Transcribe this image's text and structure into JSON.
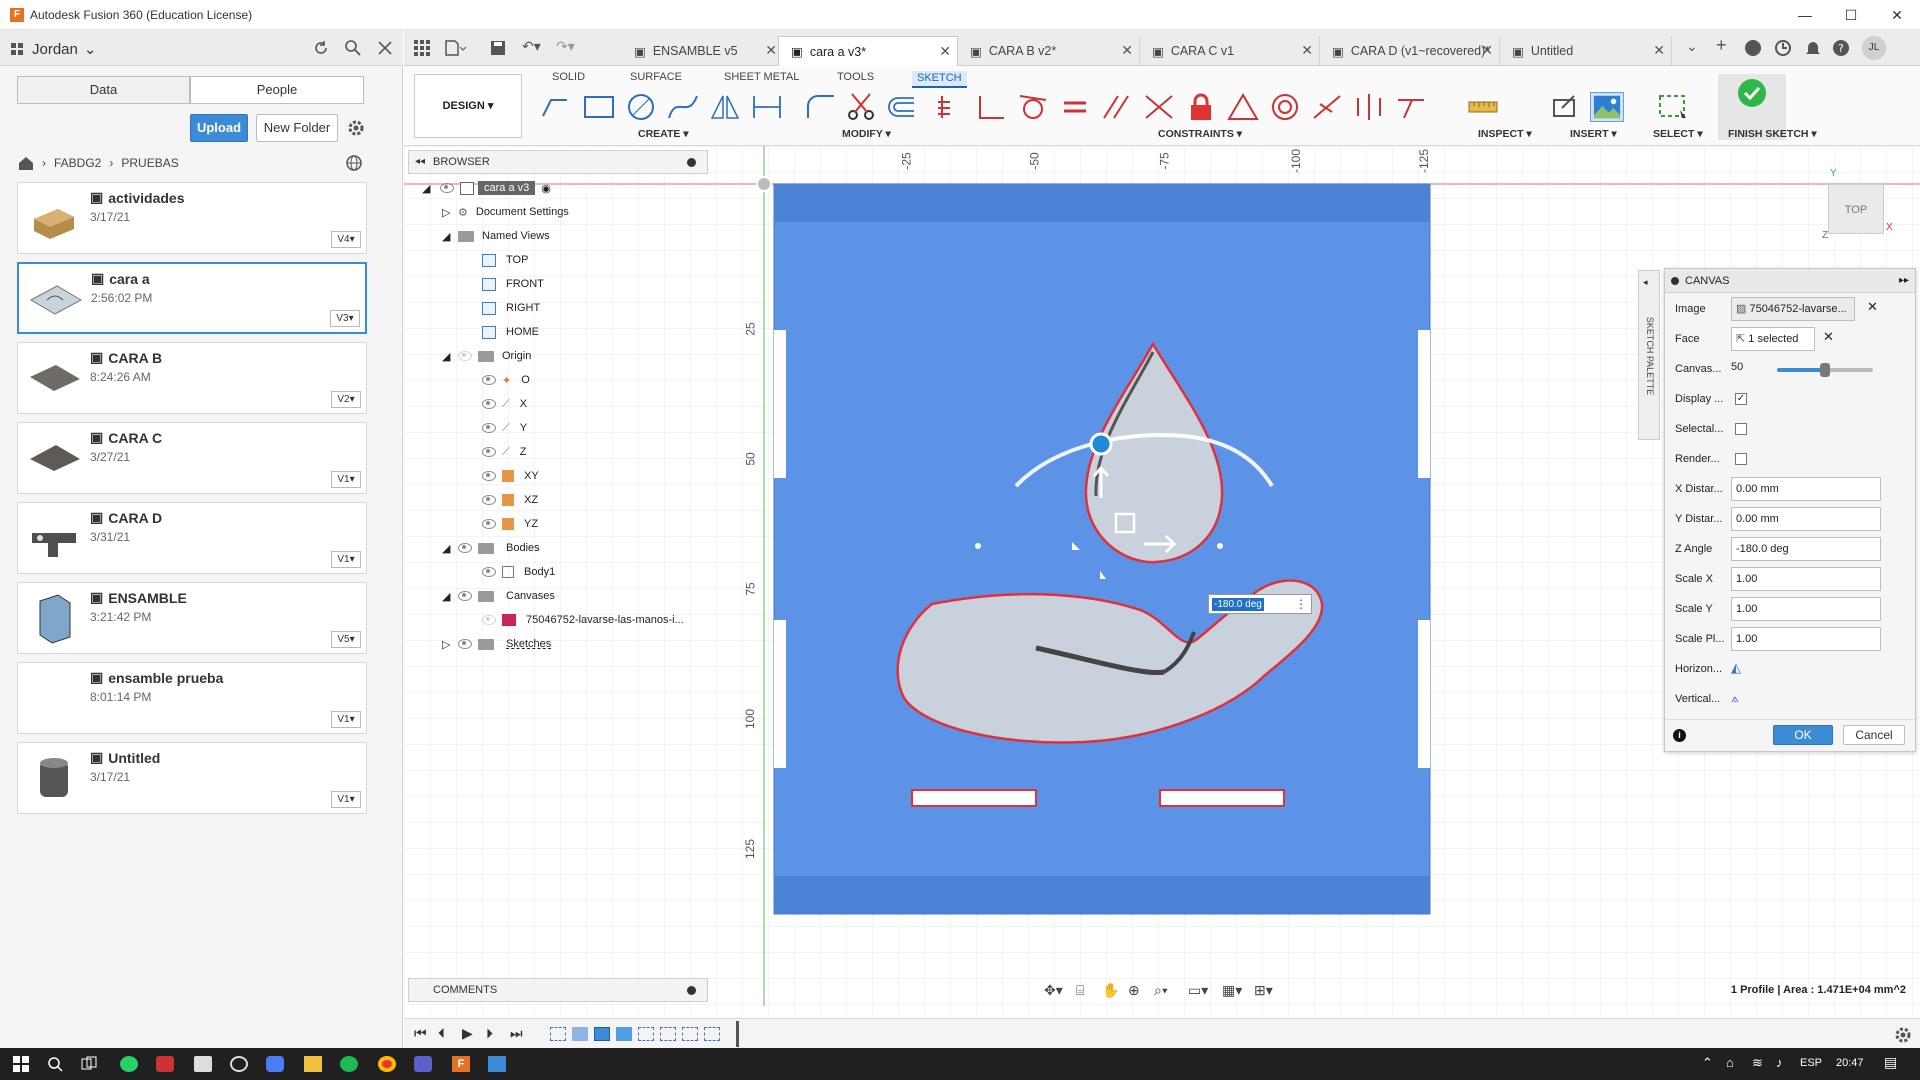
{
  "window": {
    "title": "Autodesk Fusion 360 (Education License)",
    "minimize": "—",
    "maximize": "☐",
    "close": "✕"
  },
  "data_panel": {
    "user": "Jordan",
    "tabs": [
      "Data",
      "People"
    ],
    "upload": "Upload",
    "new_folder": "New Folder",
    "breadcrumb": [
      "FABDG2",
      "PRUEBAS"
    ],
    "items": [
      {
        "name": "actividades",
        "date": "3/17/21",
        "version": "V4"
      },
      {
        "name": "cara a",
        "date": "2:56:02 PM",
        "version": "V3"
      },
      {
        "name": "CARA B",
        "date": "8:24:26 AM",
        "version": "V2"
      },
      {
        "name": "CARA C",
        "date": "3/27/21",
        "version": "V1"
      },
      {
        "name": "CARA D",
        "date": "3/31/21",
        "version": "V1"
      },
      {
        "name": "ENSAMBLE",
        "date": "3:21:42 PM",
        "version": "V5"
      },
      {
        "name": "ensamble prueba",
        "date": "8:01:14 PM",
        "version": "V1"
      },
      {
        "name": "Untitled",
        "date": "3/17/21",
        "version": "V1"
      }
    ]
  },
  "doc_tabs": [
    {
      "label": "ENSAMBLE v5",
      "active": false
    },
    {
      "label": "cara a v3*",
      "active": true
    },
    {
      "label": "CARA B v2*",
      "active": false
    },
    {
      "label": "CARA C v1",
      "active": false
    },
    {
      "label": "CARA D (v1~recovered)*",
      "active": false
    },
    {
      "label": "Untitled",
      "active": false
    }
  ],
  "toolbar": {
    "workspace": "DESIGN ▾",
    "tabs": [
      "SOLID",
      "SURFACE",
      "SHEET METAL",
      "TOOLS",
      "SKETCH"
    ],
    "groups": {
      "create": "CREATE ▾",
      "modify": "MODIFY ▾",
      "constraints": "CONSTRAINTS ▾",
      "inspect": "INSPECT ▾",
      "insert": "INSERT ▾",
      "select": "SELECT ▾",
      "finish": "FINISH SKETCH ▾"
    }
  },
  "browser": {
    "title": "BROWSER",
    "tree": [
      {
        "label": "cara a v3",
        "indent": 0
      },
      {
        "label": "Document Settings",
        "indent": 1
      },
      {
        "label": "Named Views",
        "indent": 1
      },
      {
        "label": "TOP",
        "indent": 2
      },
      {
        "label": "FRONT",
        "indent": 2
      },
      {
        "label": "RIGHT",
        "indent": 2
      },
      {
        "label": "HOME",
        "indent": 2
      },
      {
        "label": "Origin",
        "indent": 1
      },
      {
        "label": "O",
        "indent": 2
      },
      {
        "label": "X",
        "indent": 2
      },
      {
        "label": "Y",
        "indent": 2
      },
      {
        "label": "Z",
        "indent": 2
      },
      {
        "label": "XY",
        "indent": 2
      },
      {
        "label": "XZ",
        "indent": 2
      },
      {
        "label": "YZ",
        "indent": 2
      },
      {
        "label": "Bodies",
        "indent": 1
      },
      {
        "label": "Body1",
        "indent": 2
      },
      {
        "label": "Canvases",
        "indent": 1
      },
      {
        "label": "75046752-lavarse-las-manos-i...",
        "indent": 2
      },
      {
        "label": "Sketches",
        "indent": 1
      }
    ]
  },
  "rulers": {
    "top": [
      "-25",
      "-50",
      "-75",
      "-100",
      "-125"
    ],
    "left": [
      "25",
      "50",
      "75",
      "100",
      "125"
    ]
  },
  "viewcube": {
    "face": "TOP",
    "x_axis": "X",
    "y_axis": "Y",
    "z_axis": "Z"
  },
  "angle_input": "-180.0 deg",
  "sketch_palette_label": "SKETCH PALETTE",
  "canvas_dialog": {
    "title": "CANVAS",
    "rows": [
      {
        "label": "Image",
        "value": "75046752-lavarse..."
      },
      {
        "label": "Face",
        "value": "1 selected"
      },
      {
        "label": "Canvas...",
        "value": "50"
      },
      {
        "label": "Display ...",
        "value": ""
      },
      {
        "label": "Selectal...",
        "value": ""
      },
      {
        "label": "Render...",
        "value": ""
      },
      {
        "label": "X Distar...",
        "value": "0.00 mm"
      },
      {
        "label": "Y Distar...",
        "value": "0.00 mm"
      },
      {
        "label": "Z Angle",
        "value": "-180.0 deg"
      },
      {
        "label": "Scale X",
        "value": "1.00"
      },
      {
        "label": "Scale Y",
        "value": "1.00"
      },
      {
        "label": "Scale Pl...",
        "value": "1.00"
      },
      {
        "label": "Horizon...",
        "value": ""
      },
      {
        "label": "Vertical...",
        "value": ""
      }
    ],
    "opacity": 0.5,
    "display_checked": true,
    "ok": "OK",
    "cancel": "Cancel"
  },
  "comments": "COMMENTS",
  "status": "1 Profile | Area : 1.471E+04 mm^2",
  "taskbar": {
    "lang": "ESP",
    "time": "20:47"
  },
  "colors": {
    "accent": "#3b8bd6",
    "body": "#5d93e6",
    "profile_red": "#e0303a",
    "finish_green": "#2eb84b"
  }
}
